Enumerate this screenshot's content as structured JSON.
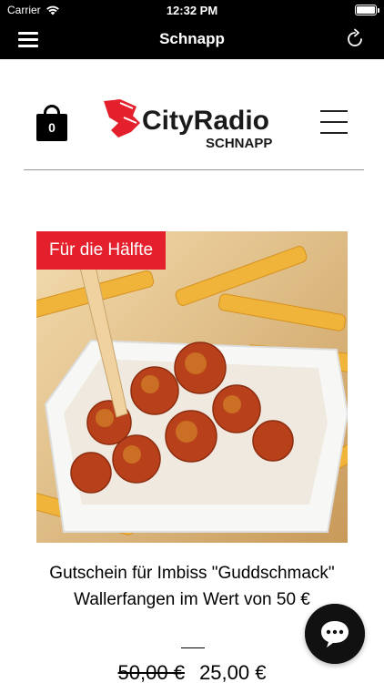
{
  "status_bar": {
    "carrier": "Carrier",
    "time": "12:32 PM"
  },
  "nav_bar": {
    "title": "Schnapp"
  },
  "header": {
    "cart_count": "0",
    "logo_main": "CityRadio",
    "logo_sub": "SCHNAPP"
  },
  "product": {
    "badge": "Für die Hälfte",
    "title": "Gutschein für Imbiss \"Guddschmack\" Wallerfangen im Wert von 50 €",
    "old_price": "50,00 €",
    "new_price": "25,00 €"
  },
  "colors": {
    "accent": "#e3202b",
    "bar": "#000000"
  },
  "icons": [
    "wifi-icon",
    "battery-icon",
    "menu-icon",
    "reload-icon",
    "cart-icon",
    "hamburger-icon",
    "chat-icon"
  ]
}
